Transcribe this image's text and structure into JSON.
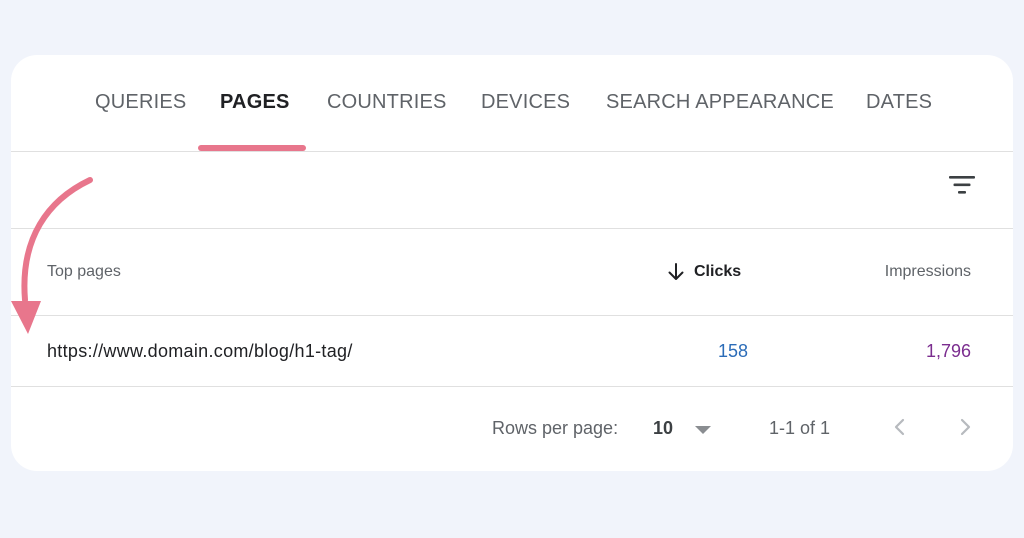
{
  "colors": {
    "page_background": "#f1f4fb",
    "card_background": "#ffffff",
    "active_tab_underline": "#e8768c",
    "annotation_arrow": "#e8768c",
    "clicks_value": "#2b6cb8",
    "impressions_value": "#7b2d8f"
  },
  "tabs": [
    {
      "label": "QUERIES",
      "active": false
    },
    {
      "label": "PAGES",
      "active": true
    },
    {
      "label": "COUNTRIES",
      "active": false
    },
    {
      "label": "DEVICES",
      "active": false
    },
    {
      "label": "SEARCH APPEARANCE",
      "active": false
    },
    {
      "label": "DATES",
      "active": false
    }
  ],
  "toolbar": {
    "filter_icon": "filter-icon"
  },
  "table": {
    "columns": {
      "page": "Top pages",
      "clicks": "Clicks",
      "impressions": "Impressions"
    },
    "sort_icon": "arrow-down-icon",
    "rows": [
      {
        "page": "https://www.domain.com/blog/h1-tag/",
        "clicks": "158",
        "impressions": "1,796"
      }
    ]
  },
  "pagination": {
    "rows_per_page_label": "Rows per page:",
    "rows_per_page_value": "10",
    "range_text": "1-1 of 1",
    "prev_icon": "chevron-left-icon",
    "next_icon": "chevron-right-icon"
  },
  "annotation": {
    "icon": "curved-arrow-icon"
  }
}
